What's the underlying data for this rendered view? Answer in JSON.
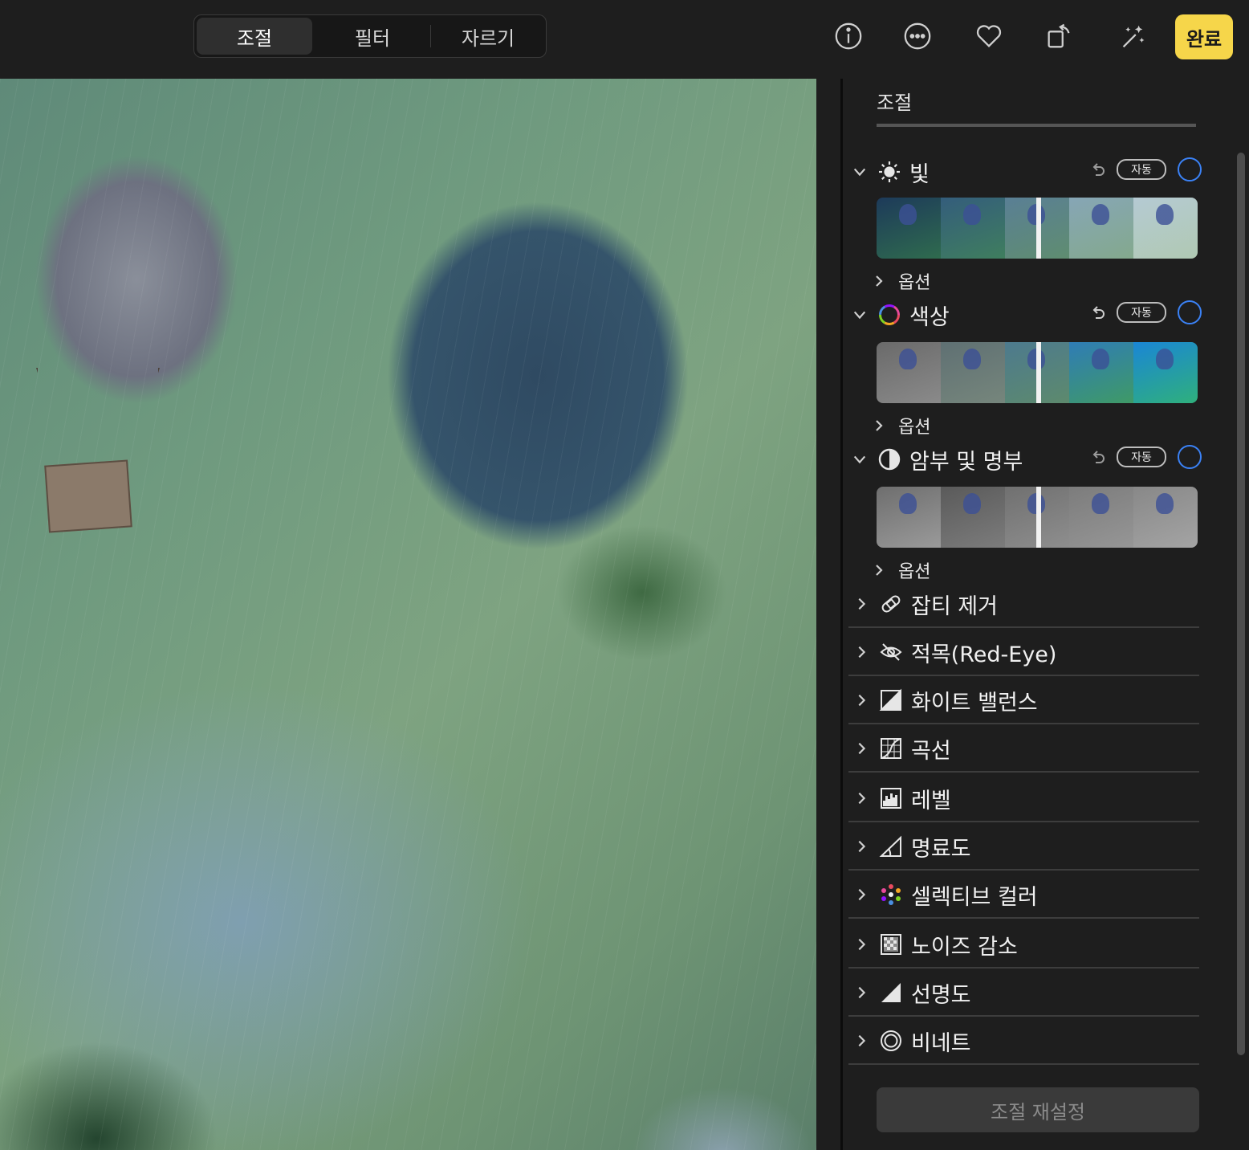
{
  "toolbar": {
    "tabs": [
      {
        "label": "조절",
        "active": true
      },
      {
        "label": "필터",
        "active": false
      },
      {
        "label": "자르기",
        "active": false
      }
    ],
    "icons": [
      "info-icon",
      "more-icon",
      "heart-icon",
      "rotate-icon",
      "magic-wand-icon"
    ],
    "done_label": "완료",
    "done_color": "#f6d64a"
  },
  "panel": {
    "title": "조절",
    "sections": [
      {
        "label": "빛",
        "icon": "sun-icon",
        "auto_label": "자동",
        "options_label": "옵션"
      },
      {
        "label": "색상",
        "icon": "color-wheel-icon",
        "auto_label": "자동",
        "options_label": "옵션"
      },
      {
        "label": "암부 및 명부",
        "icon": "half-circle-icon",
        "auto_label": "자동",
        "options_label": "옵션"
      }
    ],
    "tools": [
      {
        "label": "잡티 제거",
        "icon": "bandage-icon"
      },
      {
        "label": "적목(Red-Eye)",
        "icon": "eye-slash-icon"
      },
      {
        "label": "화이트 밸런스",
        "icon": "white-balance-icon"
      },
      {
        "label": "곡선",
        "icon": "curves-icon"
      },
      {
        "label": "레벨",
        "icon": "levels-icon"
      },
      {
        "label": "명료도",
        "icon": "definition-icon"
      },
      {
        "label": "셀렉티브 컬러",
        "icon": "selective-color-icon"
      },
      {
        "label": "노이즈 감소",
        "icon": "noise-icon"
      },
      {
        "label": "선명도",
        "icon": "sharpen-icon"
      },
      {
        "label": "비네트",
        "icon": "vignette-icon"
      }
    ],
    "reset_label": "조절 재설정",
    "accent": "#3b82f6"
  }
}
